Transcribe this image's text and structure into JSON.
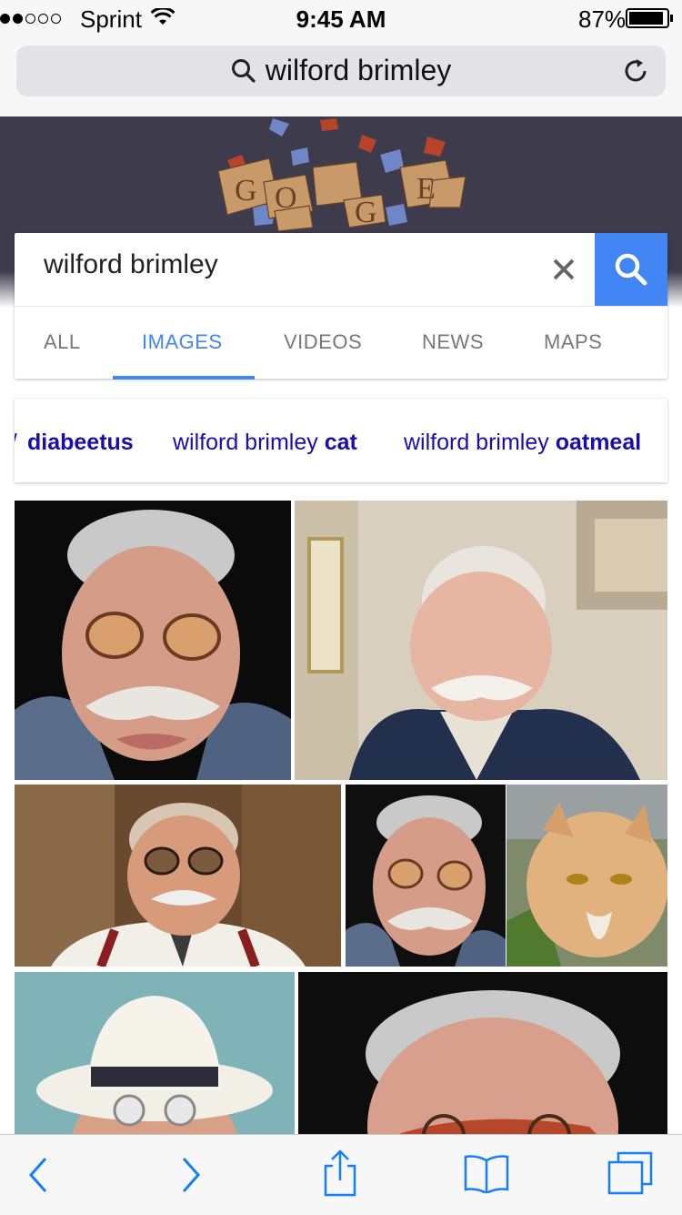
{
  "status": {
    "carrier": "Sprint",
    "time": "9:45 AM",
    "battery": "87%",
    "signal_dots_filled": 2,
    "signal_dots_total": 5,
    "battery_level": 0.87
  },
  "browser": {
    "address_query": "wilford brimley",
    "search_icon": "search-icon",
    "reload_icon": "reload-icon"
  },
  "google": {
    "doodle_icon": "google-doodle",
    "search_value": "wilford brimley",
    "clear_icon": "close-icon",
    "search_button_icon": "search-icon",
    "tabs": [
      {
        "label": "ALL",
        "active": false
      },
      {
        "label": "IMAGES",
        "active": true
      },
      {
        "label": "VIDEOS",
        "active": false
      },
      {
        "label": "NEWS",
        "active": false
      },
      {
        "label": "MAPS",
        "active": false
      }
    ],
    "suggestions": [
      {
        "plain": "",
        "bold": "diabeetus"
      },
      {
        "plain": "wilford brimley ",
        "bold": "cat"
      },
      {
        "plain": "wilford brimley ",
        "bold": "oatmeal"
      }
    ]
  },
  "images": [
    {
      "name": "photo-man-glasses-mustache"
    },
    {
      "name": "photo-man-vest-mustache"
    },
    {
      "name": "photo-man-suspenders"
    },
    {
      "name": "photo-man-glasses-closeup"
    },
    {
      "name": "photo-persian-cat"
    },
    {
      "name": "photo-man-white-hat"
    },
    {
      "name": "photo-man-forehead-closeup"
    }
  ],
  "toolbar": {
    "icons": [
      "back-icon",
      "forward-icon",
      "share-icon",
      "bookmarks-icon",
      "tabs-icon"
    ]
  },
  "colors": {
    "accent": "#4285f4",
    "suggestion_link": "#1a0dab",
    "ios_blue": "#157efb",
    "doodle_bg": "#3e3c4c"
  }
}
